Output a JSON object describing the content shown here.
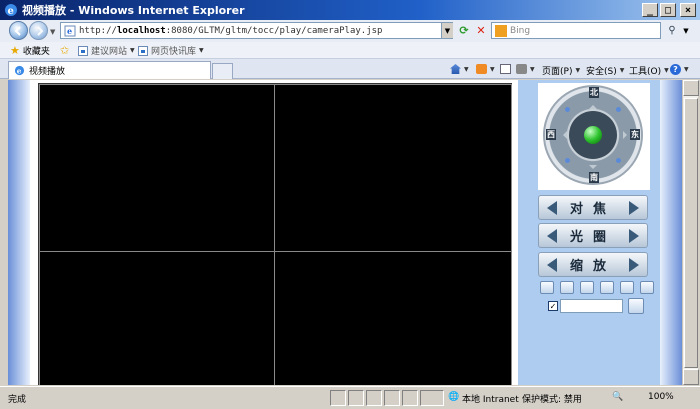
{
  "window": {
    "title": "视频播放 - Windows Internet Explorer",
    "minimize": "_",
    "maximize": "□",
    "close": "×"
  },
  "address": {
    "url_prefix": "http://",
    "url_host": "localhost",
    "url_rest": ":8080/GLTM/gltm/tocc/play/cameraPlay.jsp",
    "search_placeholder": "Bing"
  },
  "favorites_bar": {
    "favorites_label": "收藏夹",
    "suggested_sites_label": "建议网站",
    "web_slice_gallery_label": "网页快讯库"
  },
  "tab": {
    "label": "视频播放"
  },
  "command_bar": {
    "page_label": "页面(P)",
    "safety_label": "安全(S)",
    "tools_label": "工具(O)"
  },
  "ptz": {
    "north": "北",
    "south": "南",
    "east": "东",
    "west": "西"
  },
  "controls": {
    "focus_label": "对焦",
    "iris_label": "光圈",
    "zoom_label": "缩放",
    "preset_checked": "✓"
  },
  "status_bar": {
    "status_text": "完成",
    "zone_text": "本地 Intranet",
    "protected_mode_text": "保护模式: 禁用",
    "zoom_text": "100%"
  },
  "colors": {
    "title_bar": "#0a246a",
    "panel_bg": "#aecbf0",
    "video_bg": "#000000"
  }
}
